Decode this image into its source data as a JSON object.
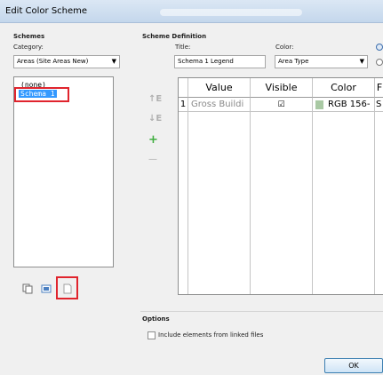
{
  "window": {
    "title": "Edit Color Scheme"
  },
  "schemes": {
    "group_label": "Schemes",
    "category_label": "Category:",
    "category_value": "Areas (Site Areas New)",
    "items": [
      {
        "label": "(none)",
        "selected": false
      },
      {
        "label": "Schema 1",
        "selected": true
      }
    ],
    "buttons": [
      {
        "icon": "duplicate-icon"
      },
      {
        "icon": "rename-icon"
      },
      {
        "icon": "new-scheme-icon"
      }
    ]
  },
  "definition": {
    "group_label": "Scheme Definition",
    "title_label": "Title:",
    "title_value": "Schema 1 Legend",
    "color_label": "Color:",
    "color_value": "Area Type",
    "move_up_label": "↑E",
    "move_down_label": "↓E",
    "add_label": "+",
    "remove_label": "—",
    "columns": [
      "Value",
      "Visible",
      "Color",
      "F"
    ],
    "rows": [
      {
        "num": "1",
        "value": "Gross Buildi",
        "visible": "☑",
        "color_text": "RGB 156-",
        "swatch": "#a9c9a4",
        "extra": "S"
      }
    ]
  },
  "options": {
    "group_label": "Options",
    "include_linked_label": "Include elements from linked files"
  },
  "footer": {
    "ok_label": "OK"
  },
  "colors": {
    "selection": "#3399ff",
    "highlight_box": "#e0242d",
    "add_icon": "#3fae3f"
  }
}
